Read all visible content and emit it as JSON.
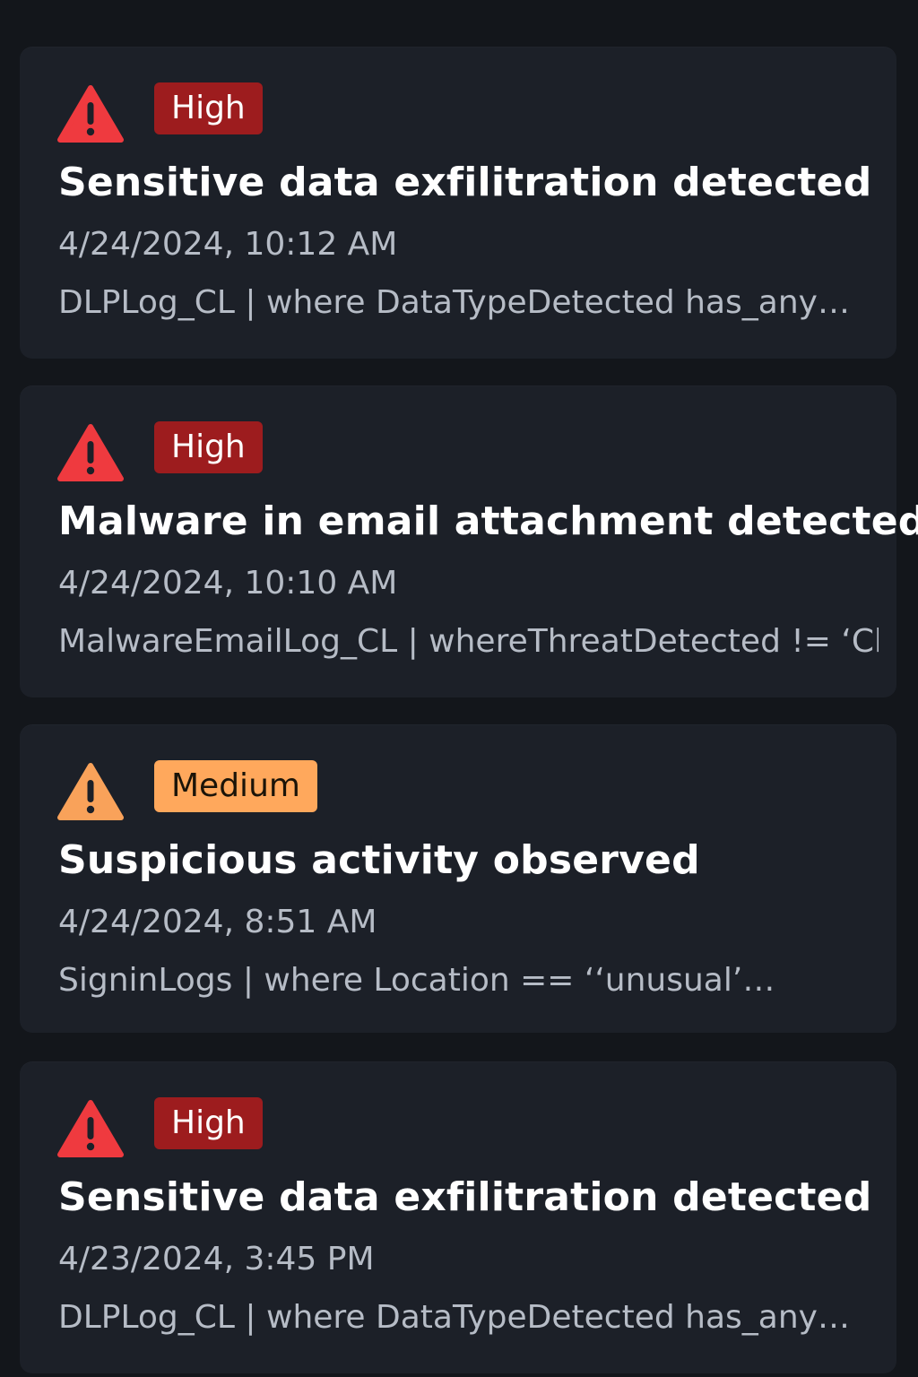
{
  "colors": {
    "background": "#13161b",
    "card": "#1c2028",
    "high_badge": "#9d1c1e",
    "high_icon": "#ef3a3f",
    "medium_badge": "#ffa85c",
    "medium_icon": "#f9a25a",
    "muted_text": "#b6bcc6"
  },
  "alerts": [
    {
      "icon": "warning-triangle-icon",
      "severity": "High",
      "title": "Sensitive data exfilitration detected",
      "time": "4/24/2024, 10:12 AM",
      "query": "DLPLog_CL | where DataTypeDetected has_any…"
    },
    {
      "icon": "warning-triangle-icon",
      "severity": "High",
      "title": "Malware in email attachment detected",
      "time": "4/24/2024, 10:10 AM",
      "query": "MalwareEmailLog_CL | whereThreatDetected != ‘Cl…"
    },
    {
      "icon": "warning-triangle-icon",
      "severity": "Medium",
      "title": "Suspicious activity observed",
      "time": "4/24/2024, 8:51 AM",
      "query": "SigninLogs | where Location == ‘‘unusual’…"
    },
    {
      "icon": "warning-triangle-icon",
      "severity": "High",
      "title": "Sensitive data exfilitration detected",
      "time": "4/23/2024, 3:45 PM",
      "query": "DLPLog_CL | where DataTypeDetected has_any…"
    }
  ]
}
